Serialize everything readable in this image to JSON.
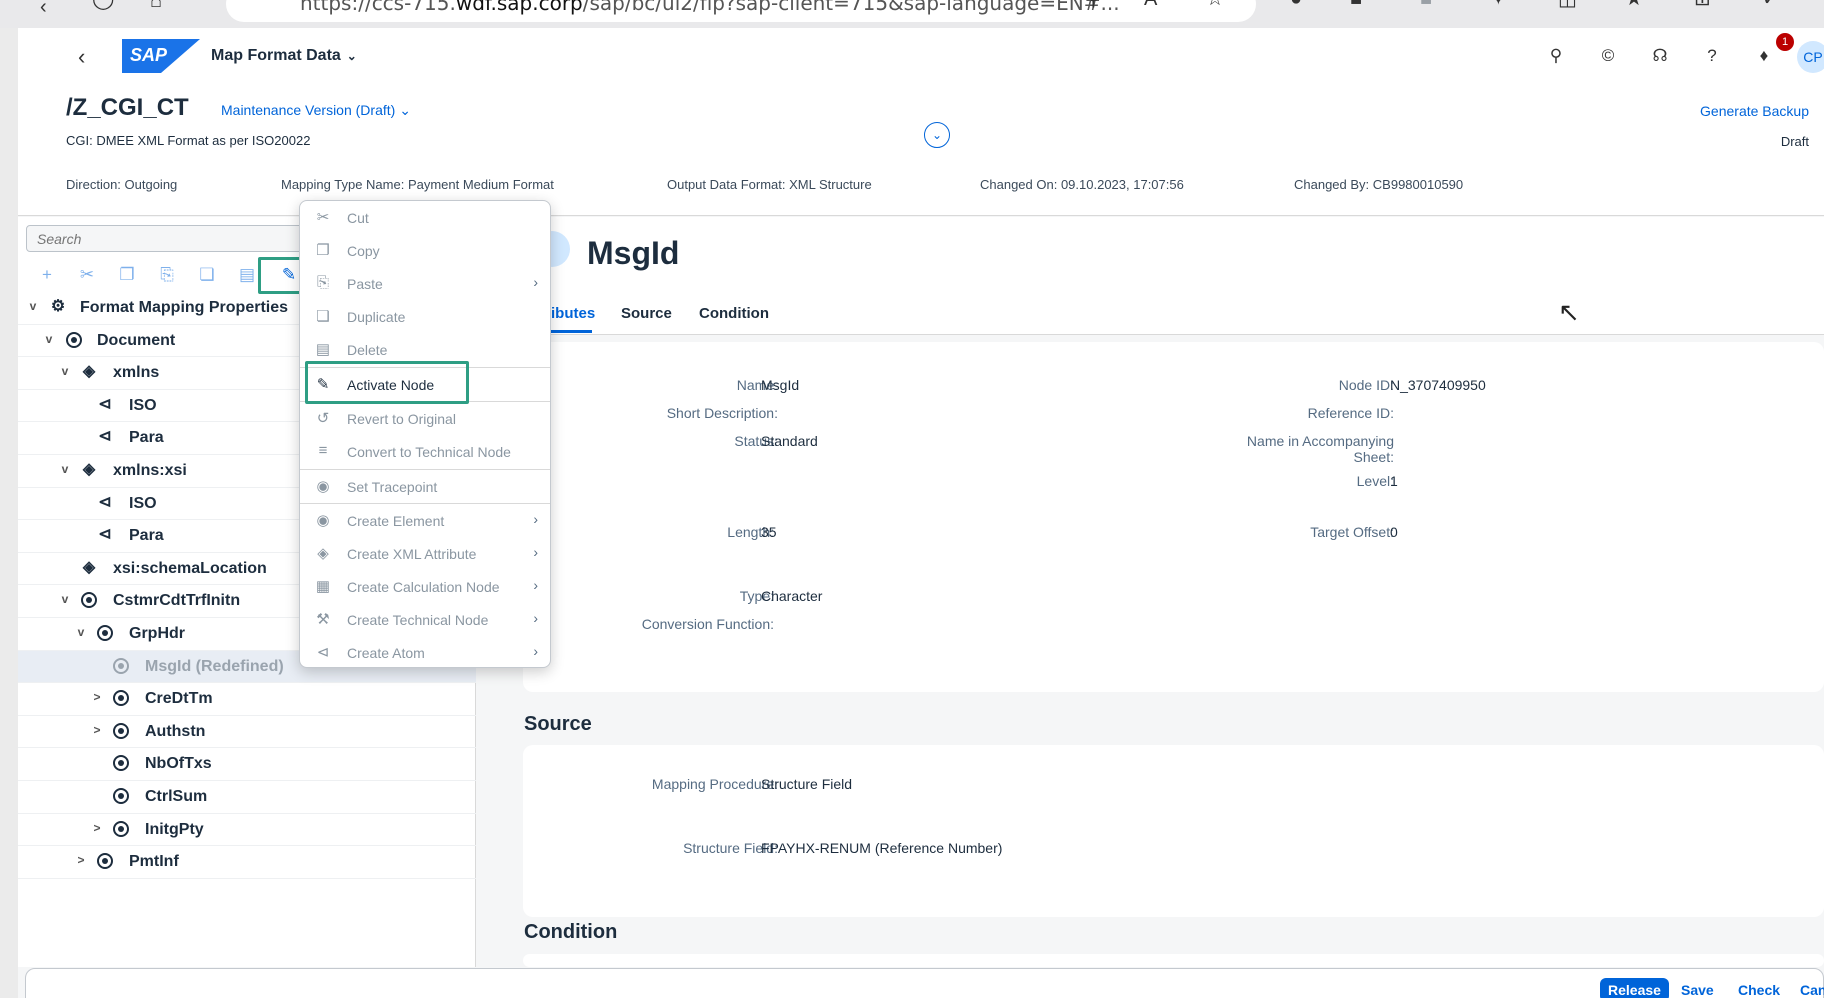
{
  "browser": {
    "url_prefix": "https://ccs-715.",
    "url_domain": "wdf.sap.corp",
    "url_suffix": "/sap/bc/ui2/flp?sap-client=715&sap-language=EN#..."
  },
  "shell": {
    "app_title": "Map Format Data",
    "avatar_initials": "CP",
    "notification_count": "1",
    "logo_text": "SAP"
  },
  "object_header": {
    "title": "/Z_CGI_CT",
    "version": "Maintenance Version (Draft)",
    "subtitle": "CGI: DMEE XML Format as per ISO20022",
    "generate_backup": "Generate Backup",
    "status": "Draft",
    "attributes": [
      "Direction: Outgoing",
      "Mapping Type Name: Payment Medium Format",
      "Output Data Format: XML Structure",
      "Changed On: 09.10.2023, 17:07:56",
      "Changed By: CB9980010590"
    ]
  },
  "tree": {
    "search_placeholder": "Search",
    "nodes": [
      {
        "label": "Format Mapping Properties",
        "icon": "gear-icon",
        "expander": "v"
      },
      {
        "label": "Document",
        "icon": "element-icon",
        "expander": "v"
      },
      {
        "label": "xmlns",
        "icon": "tag-icon",
        "expander": "v"
      },
      {
        "label": "ISO",
        "icon": "atom-icon",
        "expander": ""
      },
      {
        "label": "Para",
        "icon": "atom-icon",
        "expander": ""
      },
      {
        "label": "xmlns:xsi",
        "icon": "tag-icon",
        "expander": "v"
      },
      {
        "label": "ISO",
        "icon": "atom-icon",
        "expander": ""
      },
      {
        "label": "Para",
        "icon": "atom-icon",
        "expander": ""
      },
      {
        "label": "xsi:schemaLocation",
        "icon": "tag-icon",
        "expander": ""
      },
      {
        "label": "CstmrCdtTrfInitn",
        "icon": "element-icon",
        "expander": "v"
      },
      {
        "label": "GrpHdr",
        "icon": "element-icon",
        "expander": "v"
      },
      {
        "label": "MsgId (Redefined)",
        "icon": "element-icon",
        "expander": ""
      },
      {
        "label": "CreDtTm",
        "icon": "element-icon",
        "expander": ">"
      },
      {
        "label": "Authstn",
        "icon": "element-icon",
        "expander": ">"
      },
      {
        "label": "NbOfTxs",
        "icon": "element-icon",
        "expander": ""
      },
      {
        "label": "CtrlSum",
        "icon": "element-icon",
        "expander": ""
      },
      {
        "label": "InitgPty",
        "icon": "element-icon",
        "expander": ">"
      },
      {
        "label": "PmtInf",
        "icon": "element-icon",
        "expander": ">"
      }
    ]
  },
  "context_menu": {
    "items": [
      {
        "label": "Cut",
        "icon": "scissors-icon"
      },
      {
        "label": "Copy",
        "icon": "copy-icon"
      },
      {
        "label": "Paste",
        "icon": "paste-icon",
        "submenu": true
      },
      {
        "label": "Duplicate",
        "icon": "duplicate-icon"
      },
      {
        "label": "Delete",
        "icon": "trash-icon"
      },
      {
        "label": "Activate Node",
        "icon": "activate-icon",
        "enabled": true
      },
      {
        "label": "Revert to Original",
        "icon": "revert-icon"
      },
      {
        "label": "Convert to Technical Node",
        "icon": "technical-icon"
      },
      {
        "label": "Set Tracepoint",
        "icon": "tracepoint-icon"
      },
      {
        "label": "Create Element",
        "icon": "element-icon",
        "submenu": true
      },
      {
        "label": "Create XML Attribute",
        "icon": "tag-icon",
        "submenu": true
      },
      {
        "label": "Create Calculation Node",
        "icon": "calculator-icon",
        "submenu": true
      },
      {
        "label": "Create Technical Node",
        "icon": "wrench-icon",
        "submenu": true
      },
      {
        "label": "Create Atom",
        "icon": "atom-icon",
        "submenu": true
      }
    ]
  },
  "detail": {
    "title": "MsgId",
    "tabs": [
      "ibutes",
      "Source",
      "Condition"
    ],
    "attributes": {
      "name_label": "Name:",
      "name_value": "MsgId",
      "short_desc_label": "Short Description:",
      "status_label": "Status:",
      "status_value": "Standard",
      "length_label": "Length:",
      "length_value": "35",
      "type_label": "Type:",
      "type_value": "Character",
      "conversion_label": "Conversion Function:",
      "node_id_label": "Node ID:",
      "node_id_value": "N_3707409950",
      "reference_id_label": "Reference ID:",
      "accompanying_label_1": "Name in Accompanying",
      "accompanying_label_2": "Sheet:",
      "level_label": "Level:",
      "level_value": "1",
      "target_offset_label": "Target Offset:",
      "target_offset_value": "0"
    },
    "source": {
      "section_title": "Source",
      "mapping_procedure_label": "Mapping Procedure:",
      "mapping_procedure_value": "Structure Field",
      "structure_field_label": "Structure Field:",
      "structure_field_value": "FPAYHX-RENUM (Reference Number)"
    },
    "condition_title": "Condition"
  },
  "footer": {
    "release": "Release",
    "save": "Save",
    "check": "Check",
    "cancel": "Can"
  },
  "colors": {
    "accent": "#0064d9",
    "highlight": "#2e9e84"
  }
}
